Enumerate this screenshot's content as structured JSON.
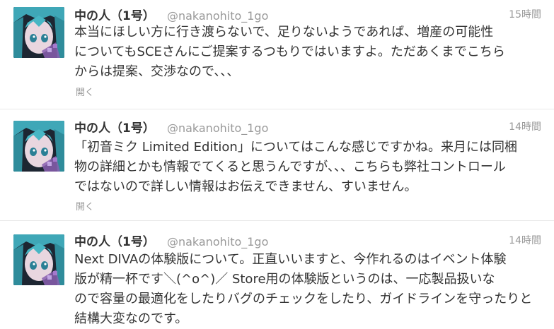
{
  "colors": {
    "name": "#333333",
    "meta": "#999999",
    "divider": "#e8e8e8",
    "avatar_hair": "#3fa7b7",
    "avatar_bg": "#14171f"
  },
  "tweets": [
    {
      "name": "中の人（1号）",
      "handle": "@nakanohito_1go",
      "time": "15時間",
      "lines": [
        "本当にほしい方に行き渡らないで、足りないようであれば、増産の可能性",
        "についてもSCEさんにご提案するつもりではいますよ。ただあくまでこちら",
        "からは提案、交渉なので、、、"
      ],
      "expand": "開く",
      "avatar_icon": "avatar-icon"
    },
    {
      "name": "中の人（1号）",
      "handle": "@nakanohito_1go",
      "time": "14時間",
      "lines": [
        "「初音ミク Limited Edition」についてはこんな感じですかね。来月には同梱",
        "物の詳細とかも情報でてくると思うんですが、、、こちらも弊社コントロール",
        "ではないので詳しい情報はお伝えできません、すいません。"
      ],
      "expand": "開く",
      "avatar_icon": "avatar-icon"
    },
    {
      "name": "中の人（1号）",
      "handle": "@nakanohito_1go",
      "time": "14時間",
      "lines": [
        "Next DIVAの体験版について。正直いいますと、今作れるのはイベント体験",
        "版が精一杯です＼(^o^)／ Store用の体験版というのは、一応製品扱いな",
        "ので容量の最適化をしたりバグのチェックをしたり、ガイドラインを守ったりと",
        "結構大変なのです。"
      ],
      "avatar_icon": "avatar-icon"
    }
  ]
}
